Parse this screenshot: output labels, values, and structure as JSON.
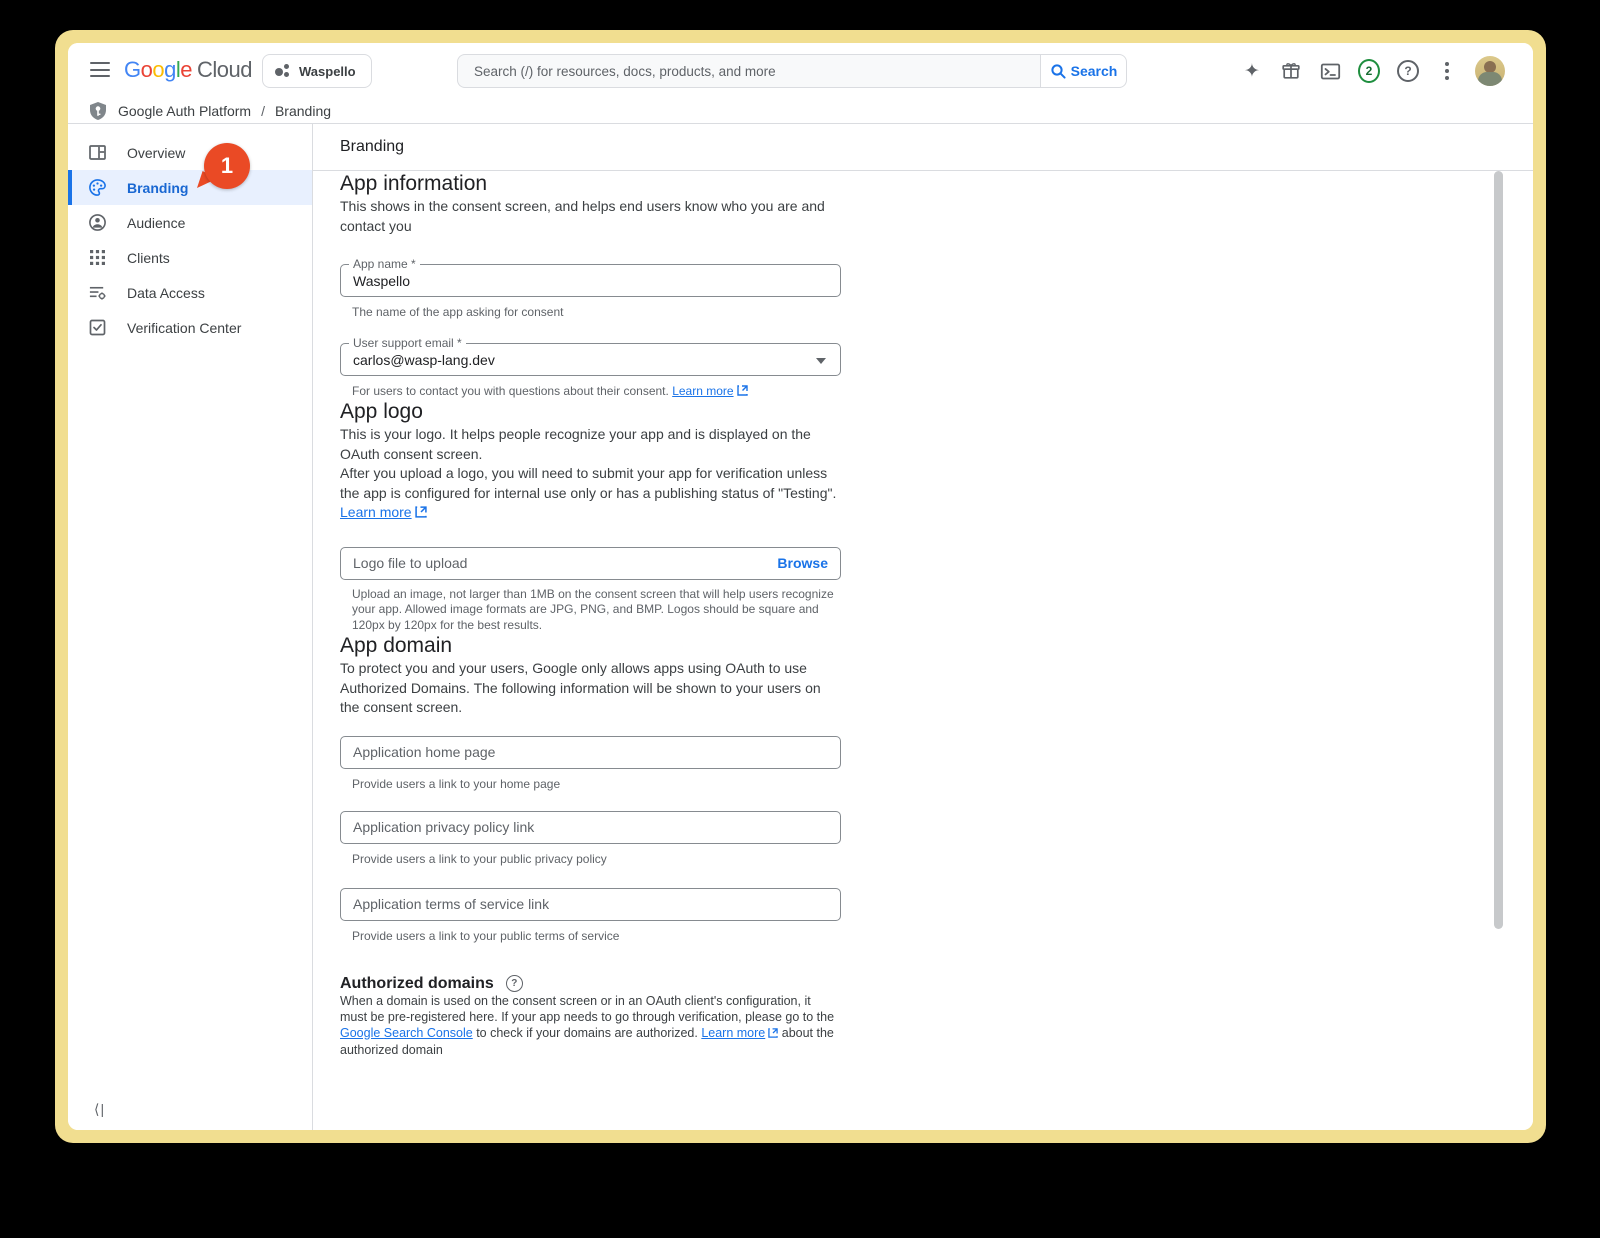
{
  "header": {
    "logo": {
      "letters": [
        "G",
        "o",
        "o",
        "g",
        "l",
        "e"
      ],
      "cloud": "Cloud"
    },
    "project": "Waspello",
    "search_placeholder": "Search (/) for resources, docs, products, and more",
    "search_button": "Search",
    "notifications": "2",
    "help_glyph": "?",
    "colors": {
      "brand_blue": "#4285F4",
      "brand_red": "#EA4335",
      "brand_yellow": "#FBBC04",
      "brand_green": "#34A853",
      "link_blue": "#1a73e8",
      "selected_bg": "#e8f0fe",
      "badge_orange": "#ea4a25",
      "notification_green": "#1e8e3e"
    }
  },
  "breadcrumb": {
    "root": "Google Auth Platform",
    "separator": "/",
    "current": "Branding"
  },
  "sidebar": {
    "items": [
      {
        "label": "Overview"
      },
      {
        "label": "Branding",
        "badge": "1"
      },
      {
        "label": "Audience"
      },
      {
        "label": "Clients"
      },
      {
        "label": "Data Access"
      },
      {
        "label": "Verification Center"
      }
    ],
    "collapse_glyph": "⟨|"
  },
  "page": {
    "title": "Branding",
    "app_information": {
      "heading": "App information",
      "description": "This shows in the consent screen, and helps end users know who you are and contact you",
      "app_name_label": "App name *",
      "app_name_value": "Waspello",
      "app_name_helper": "The name of the app asking for consent",
      "email_label": "User support email *",
      "email_value": "carlos@wasp-lang.dev",
      "email_helper": "For users to contact you with questions about their consent. ",
      "email_helper_link": "Learn more"
    },
    "app_logo": {
      "heading": "App logo",
      "line1": "This is your logo. It helps people recognize your app and is displayed on the OAuth consent screen.",
      "line2": "After you upload a logo, you will need to submit your app for verification unless the app is configured for internal use only or has a publishing status of \"Testing\".",
      "learn_more": "Learn more",
      "upload_placeholder": "Logo file to upload",
      "browse": "Browse",
      "upload_helper": "Upload an image, not larger than 1MB on the consent screen that will help users recognize your app. Allowed image formats are JPG, PNG, and BMP. Logos should be square and 120px by 120px for the best results."
    },
    "app_domain": {
      "heading": "App domain",
      "description": "To protect you and your users, Google only allows apps using OAuth to use Authorized Domains. The following information will be shown to your users on the consent screen.",
      "fields": [
        {
          "placeholder": "Application home page",
          "helper": "Provide users a link to your home page"
        },
        {
          "placeholder": "Application privacy policy link",
          "helper": "Provide users a link to your public privacy policy"
        },
        {
          "placeholder": "Application terms of service link",
          "helper": "Provide users a link to your public terms of service"
        }
      ]
    },
    "authorized_domains": {
      "heading": "Authorized domains",
      "seg1": "When a domain is used on the consent screen or in an OAuth client's configuration, it must be pre-registered here. If your app needs to go through verification, please go to the ",
      "link1": "Google Search Console",
      "seg2": " to check if your domains are authorized. ",
      "link2": "Learn more",
      "seg3": " about the authorized domain"
    }
  }
}
